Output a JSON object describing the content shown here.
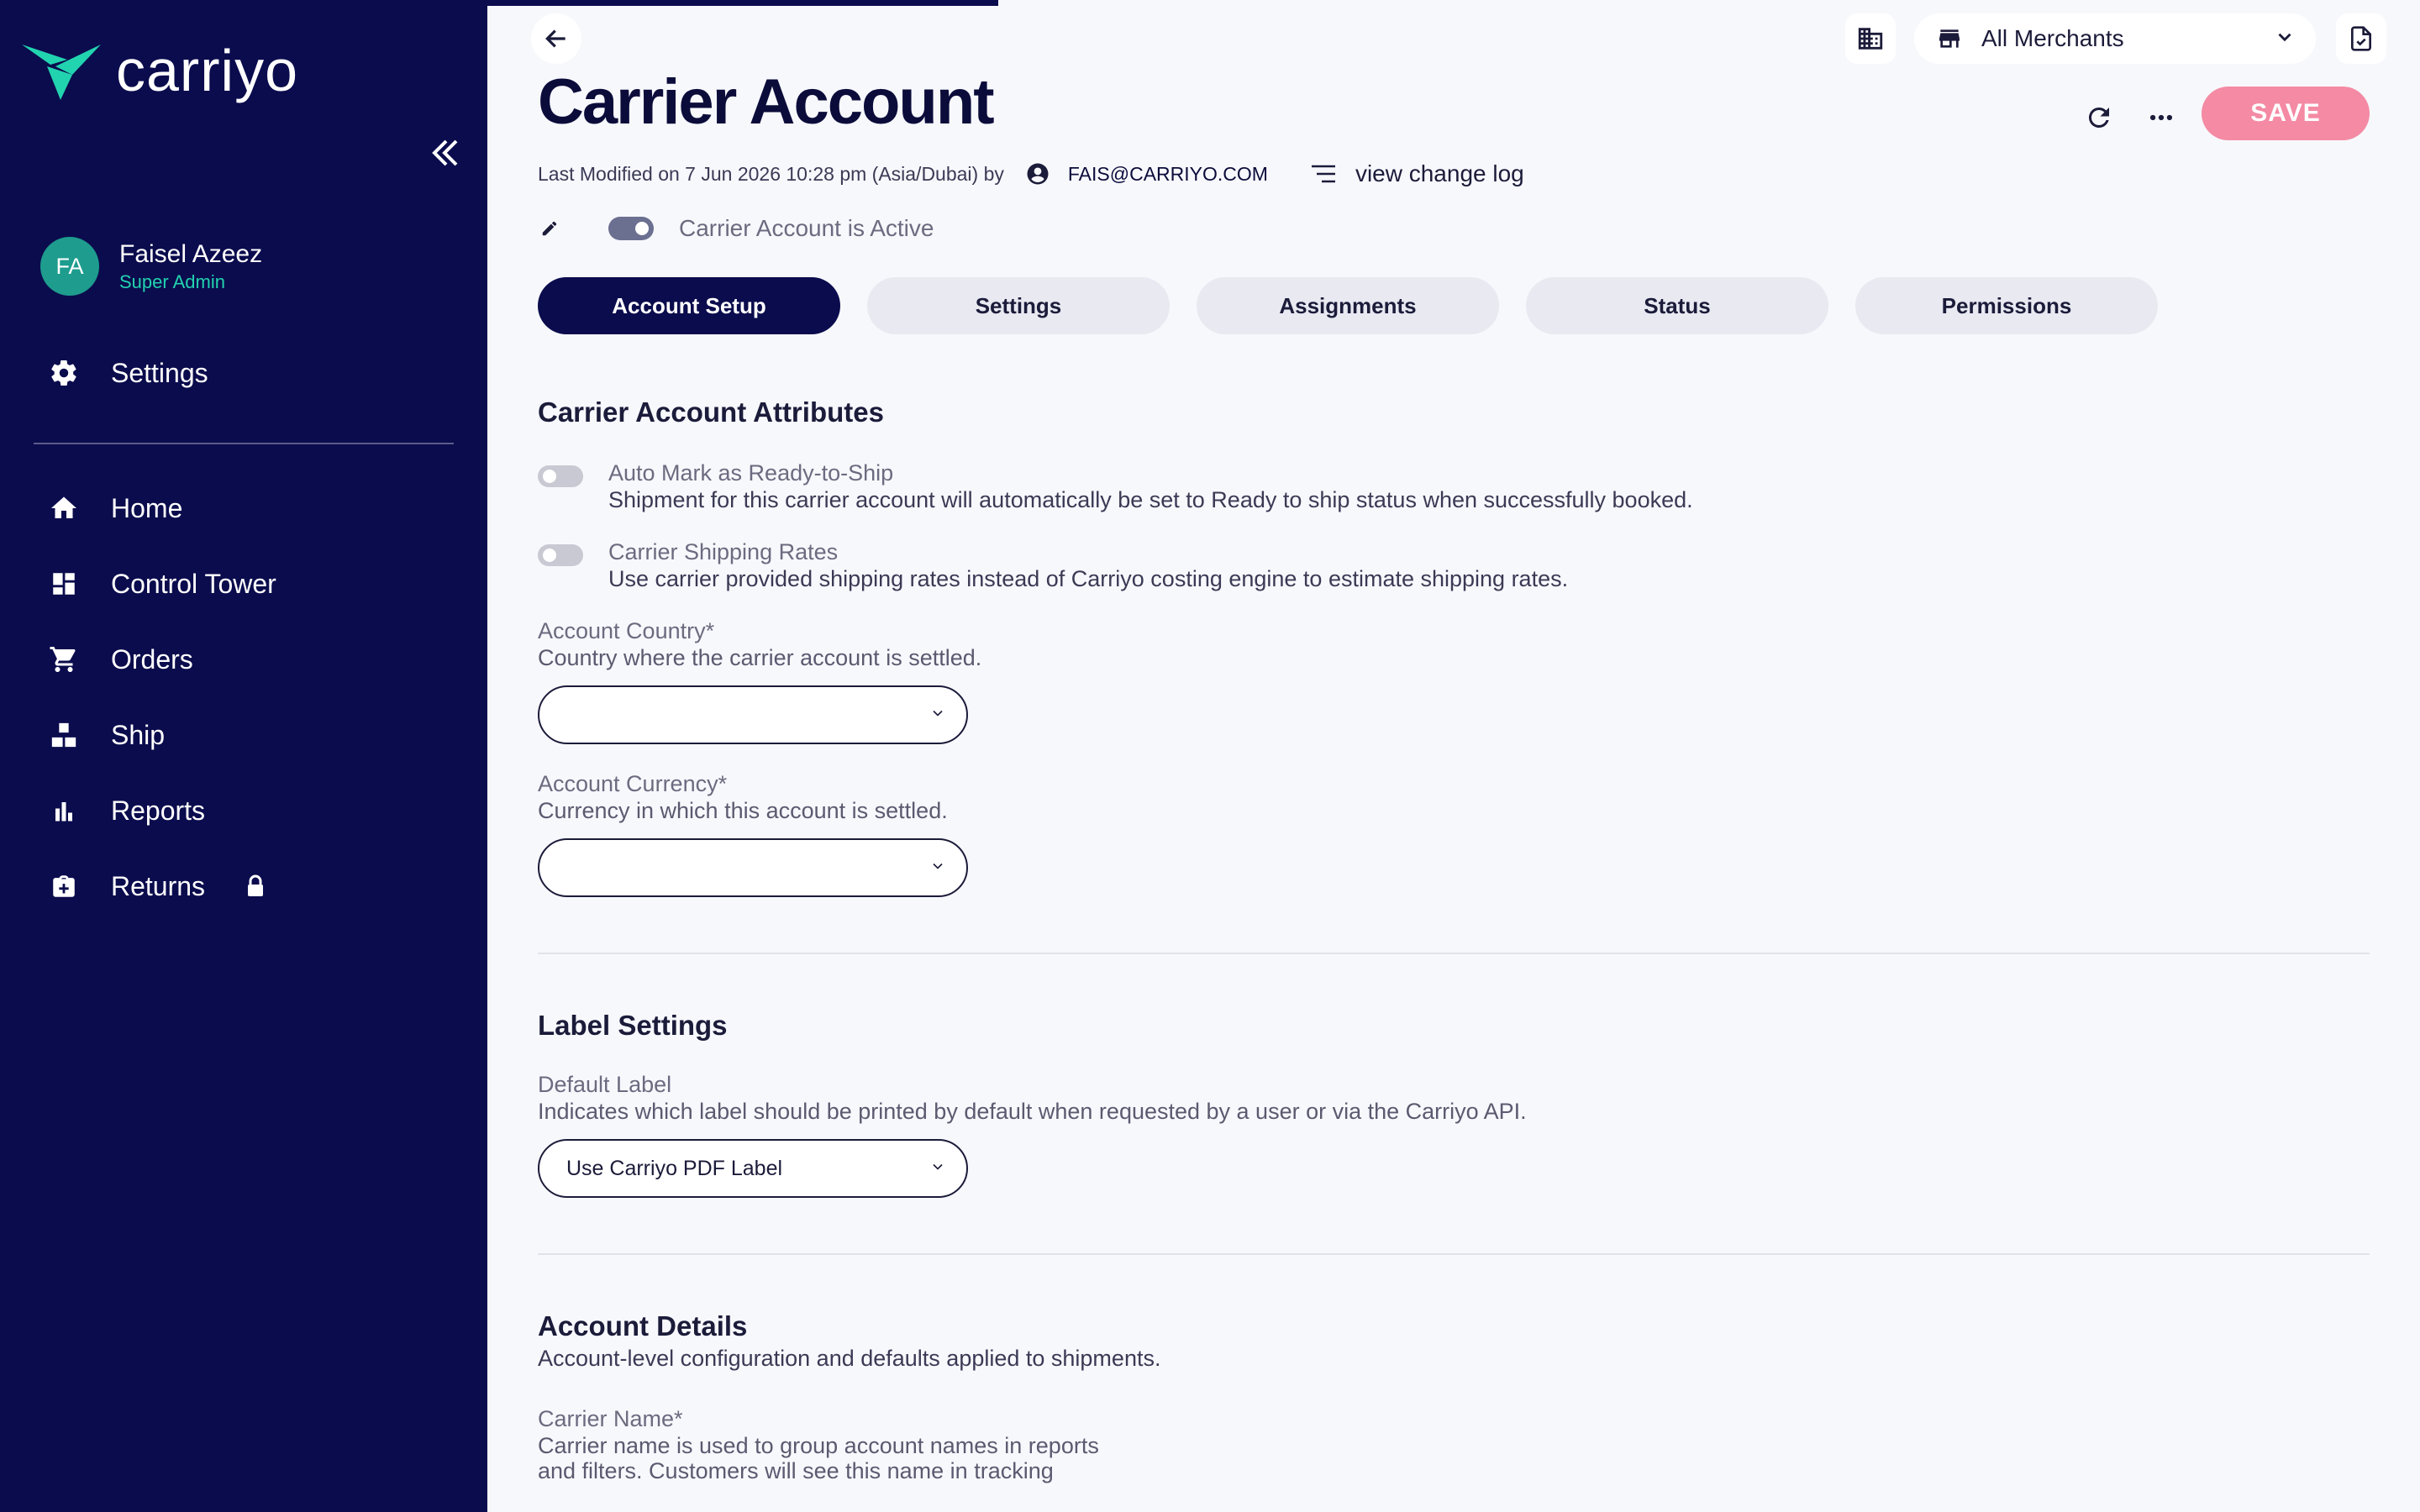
{
  "brand": {
    "name": "carriyo"
  },
  "user": {
    "initials": "FA",
    "name": "Faisel Azeez",
    "role": "Super Admin"
  },
  "sidebar": {
    "settings_label": "Settings",
    "items": [
      {
        "label": "Home",
        "icon": "home-icon"
      },
      {
        "label": "Control Tower",
        "icon": "dashboard-icon"
      },
      {
        "label": "Orders",
        "icon": "cart-icon"
      },
      {
        "label": "Ship",
        "icon": "boxes-icon"
      },
      {
        "label": "Reports",
        "icon": "bar-chart-icon"
      },
      {
        "label": "Returns",
        "icon": "return-box-icon",
        "locked": true
      }
    ]
  },
  "header": {
    "title": "Carrier Account",
    "merchant_select": "All Merchants",
    "save_label": "SAVE",
    "last_modified_prefix": "Last Modified on 7 Jun 2026 10:28 pm (Asia/Dubai) by",
    "modified_by": "FAIS@CARRIYO.COM",
    "change_log_label": "view change log",
    "active_label": "Carrier Account is Active",
    "active": true
  },
  "tabs": [
    {
      "label": "Account Setup",
      "active": true
    },
    {
      "label": "Settings",
      "active": false
    },
    {
      "label": "Assignments",
      "active": false
    },
    {
      "label": "Status",
      "active": false
    },
    {
      "label": "Permissions",
      "active": false
    }
  ],
  "attributes": {
    "title": "Carrier Account Attributes",
    "auto_mark": {
      "title": "Auto Mark as Ready-to-Ship",
      "desc": "Shipment for this carrier account will automatically be set to Ready to ship status when successfully booked.",
      "enabled": false
    },
    "shipping_rates": {
      "title": "Carrier Shipping Rates",
      "desc": "Use carrier provided shipping rates instead of Carriyo costing engine to estimate shipping rates.",
      "enabled": false
    },
    "account_country": {
      "label": "Account Country*",
      "help": "Country where the carrier account is settled.",
      "value": ""
    },
    "account_currency": {
      "label": "Account Currency*",
      "help": "Currency in which this account is settled.",
      "value": ""
    }
  },
  "label_settings": {
    "title": "Label Settings",
    "default_label": {
      "label": "Default Label",
      "help": "Indicates which label should be printed by default when requested by a user or via the Carriyo API.",
      "value": "Use Carriyo PDF Label"
    }
  },
  "account_details": {
    "title": "Account Details",
    "subtitle": "Account-level configuration and defaults applied to shipments.",
    "carrier_name": {
      "label": "Carrier Name*",
      "help_line1": "Carrier name is used to group account names in reports",
      "help_line2": "and filters. Customers will see this name in tracking"
    }
  },
  "colors": {
    "sidebar_bg": "#0b0c4d",
    "accent_green": "#22d3b0",
    "save_pink": "#f48aa4",
    "page_bg": "#f7f8fc"
  }
}
